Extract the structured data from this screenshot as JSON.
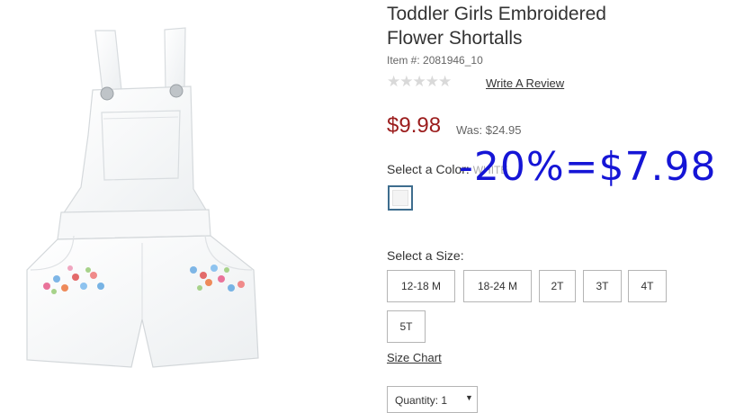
{
  "product": {
    "title_line1": "Toddler Girls Embroidered",
    "title_line2": "Flower Shortalls",
    "item_number": "Item #: 2081946_10",
    "stars": "★★★★★",
    "review_link": "Write A Review",
    "price": "$9.98",
    "was_price": "Was: $24.95",
    "image_alt": "white denim shortalls with embroidered flowers"
  },
  "color": {
    "label": "Select a Color:",
    "value": "WHITE",
    "swatch_color": "#f4f4f4"
  },
  "annotation": "-20%=$7.98",
  "size": {
    "label": "Select a Size:",
    "options": [
      "12-18 M",
      "18-24 M",
      "2T",
      "3T",
      "4T",
      "5T"
    ]
  },
  "size_chart": "Size Chart",
  "quantity": {
    "label": "Quantity: 1",
    "caret": "▼"
  },
  "colors": {
    "price_red": "#9b1c1c",
    "annotation_blue": "#1515d6",
    "swatch_border": "#3e6d8e"
  }
}
